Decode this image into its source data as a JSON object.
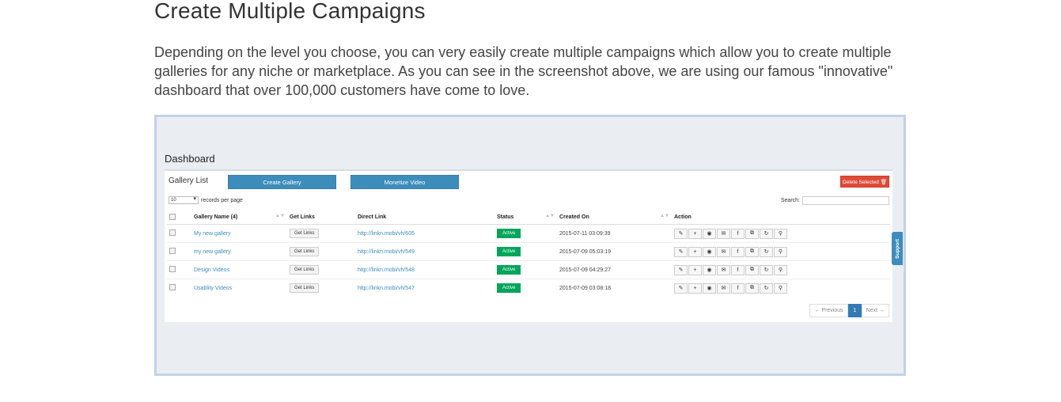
{
  "article": {
    "heading": "Create Multiple Campaigns",
    "intro": "Depending on the level you choose, you can very easily create multiple campaigns which allow you to create multiple galleries for any niche or marketplace. As you can see in the screenshot above, we are using our famous \"innovative\" dashboard that over 100,000 customers have come to love."
  },
  "dashboard": {
    "title": "Dashboard",
    "panel_title": "Gallery List",
    "create_gallery": "Create Gallery",
    "monetize_video": "Monetize Video",
    "delete_selected": "Delete Selected 🗑",
    "records_value": "10",
    "records_label": "records per page",
    "search_label": "Search:",
    "support_label": "Support",
    "columns": [
      "Gallery Name (4)",
      "Get Links",
      "Direct Link",
      "Status",
      "Created On",
      "Action"
    ],
    "rows": [
      {
        "name": "My new gallery",
        "get_links": "Get Links",
        "link": "http://linkn.mobi/vh/605",
        "status": "Active",
        "created": "2015-07-11 03:09:39"
      },
      {
        "name": "my new gallery",
        "get_links": "Get Links",
        "link": "http://linkn.mobi/vh/549",
        "status": "Active",
        "created": "2015-07-09 05:03:19"
      },
      {
        "name": "Design Videos",
        "get_links": "Get Links",
        "link": "http://linkn.mobi/vh/548",
        "status": "Active",
        "created": "2015-07-09 04:29:27"
      },
      {
        "name": "Usablity Videos",
        "get_links": "Get Links",
        "link": "http://linkn.mobi/vh/547",
        "status": "Active",
        "created": "2015-07-09 03:08:18"
      }
    ],
    "action_icons": [
      "edit-icon",
      "add-icon",
      "view-icon",
      "email-icon",
      "facebook-icon",
      "copy-icon",
      "refresh-icon",
      "link-icon"
    ],
    "pagination": {
      "previous": "← Previous",
      "page": "1",
      "next": "Next →"
    },
    "colors": {
      "primary": "#3c8dbc",
      "danger": "#dd4b39",
      "success": "#00a65a"
    }
  }
}
